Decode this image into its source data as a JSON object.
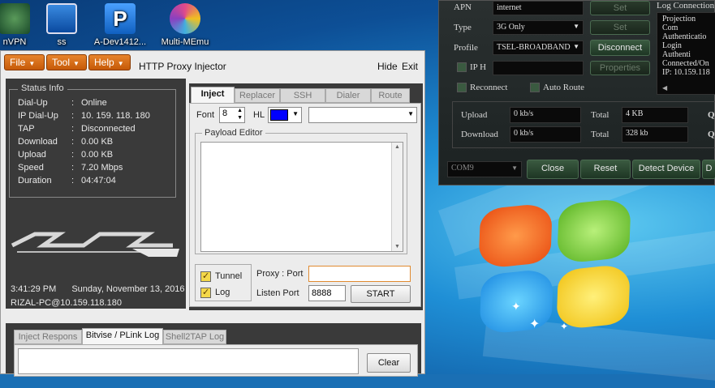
{
  "desktop": {
    "icons": [
      {
        "label": "nVPN"
      },
      {
        "label": "ss"
      },
      {
        "label": "A-Dev1412..."
      },
      {
        "label": "Multi-MEmu"
      }
    ]
  },
  "injector": {
    "menu": {
      "file": "File",
      "tool": "Tool",
      "help": "Help"
    },
    "title": "HTTP Proxy Injector",
    "hide": "Hide",
    "exit": "Exit",
    "status": {
      "header": "Status Info",
      "rows": [
        {
          "key": "Dial-Up",
          "value": "Online"
        },
        {
          "key": "IP Dial-Up",
          "value": "10. 159. 118. 180"
        },
        {
          "key": "TAP",
          "value": "Disconnected"
        },
        {
          "key": "Download",
          "value": "0.00 KB"
        },
        {
          "key": "Upload",
          "value": "0.00 KB"
        },
        {
          "key": "Speed",
          "value": "7.20 Mbps"
        },
        {
          "key": "Duration",
          "value": "04:47:04"
        }
      ]
    },
    "clock": {
      "time": "3:41:29 PM",
      "date": "Sunday, November 13, 2016"
    },
    "host": "RIZAL-PC@10.159.118.180",
    "tabs": [
      "Inject",
      "Replacer",
      "SSH",
      "Dialer",
      "Route"
    ],
    "font_label": "Font",
    "font_value": "8",
    "hl_label": "HL",
    "hl_color": "#0000ff",
    "payload_header": "Payload Editor",
    "tunnel_label": "Tunnel",
    "log_label": "Log",
    "proxy_label": "Proxy : Port",
    "proxy_value": "",
    "listen_label": "Listen Port",
    "listen_value": "8888",
    "start_label": "START",
    "bottom_tabs": [
      "Inject Respons",
      "Bitvise / PLink Log",
      "Shell2TAP Log"
    ],
    "clear_label": "Clear"
  },
  "modem": {
    "apn_label": "APN",
    "apn_value": "internet",
    "set1": "Set",
    "type_label": "Type",
    "type_value": "3G Only",
    "set2": "Set",
    "profile_label": "Profile",
    "profile_value": "TSEL-BROADBAND",
    "disconnect": "Disconnect",
    "iph_label": "IP H",
    "properties": "Properties",
    "reconnect": "Reconnect",
    "auto_route": "Auto Route",
    "log_title": "Log Connection",
    "log_lines": [
      "Projection Com",
      "Authenticatio",
      "Login Authenti",
      "Connected/On",
      "IP: 10.159.118"
    ],
    "upload_label": "Upload",
    "upload_value": "0 kb/s",
    "download_label": "Download",
    "download_value": "0 kb/s",
    "total_label": "Total",
    "total_up": "4 KB",
    "total_down": "328 kb",
    "q1": "Q",
    "q2": "Q",
    "com_value": "COM9",
    "close": "Close",
    "reset": "Reset",
    "detect": "Detect Device",
    "extra": "D"
  }
}
